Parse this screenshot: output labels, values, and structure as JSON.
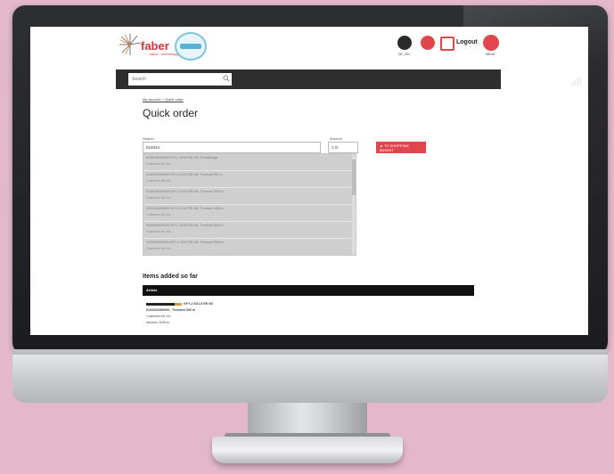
{
  "header": {
    "logo_text": "faber",
    "logo_subtitle": "kabel · technology",
    "language_caption": "DE | EN",
    "logout_label": "Logout",
    "menu_caption": "MENU"
  },
  "searchbar": {
    "placeholder": "Search"
  },
  "breadcrumb": "My account > Quick order",
  "page_title": "Quick order",
  "form": {
    "search_label": "Search",
    "search_value": "010024",
    "amount_label": "Amount",
    "amount_value": "1 m",
    "add_button_label": "▲ TO SHOPPING BASKET"
  },
  "suggestions": [
    {
      "name": "0100240400000 NYY-J 4X10 RE 0/6, Schnittlänge",
      "customer": "Customer Art.-Nr.:"
    },
    {
      "name": "0100240405000 NYY-J 4X10 RE 0/6, Trommel 500 m",
      "customer": "Customer Art.-Nr.:"
    },
    {
      "name": "0100240410000 NYY-J 4X10 RE 0/6, Trommel 1000 m",
      "customer": "Customer Art.-Nr.:"
    },
    {
      "name": "0100240415000 NYY-J 4X10 RE 0/6, Trommel 1500 m",
      "customer": "Customer Art.-Nr.:"
    },
    {
      "name": "0100240420000 NYY-J 4X10 RE 0/6, Trommel 2000 m",
      "customer": "Customer Art.-Nr.:"
    },
    {
      "name": "0100240425000 NYY-J 4X10 RE 0/6, Trommel 2500 m",
      "customer": "Customer Art.-Nr.:"
    }
  ],
  "items_heading": "Items added so far",
  "table": {
    "col_article": "Article"
  },
  "added_item": {
    "title": "NYY-J 5G1,5 RE 0/6",
    "number": "0100020400000 , Trommel 500 m",
    "customer": "Customer Art.-Nr.:",
    "amount": "Amount: 2000 m"
  },
  "colors": {
    "accent": "#e0474c",
    "dark_bar": "#2e2e2e",
    "background": "#e3b8c9"
  }
}
